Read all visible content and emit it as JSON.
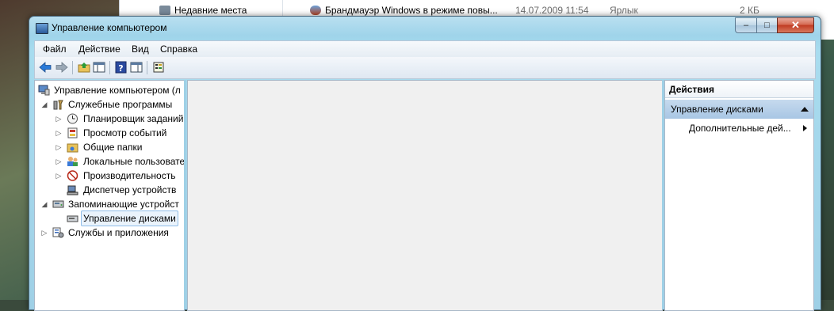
{
  "background": {
    "nav_item": "Недавние места",
    "file": {
      "name": "Брандмауэр Windows в режиме повы...",
      "date": "14.07.2009 11:54",
      "type": "Ярлык",
      "size": "2 КБ"
    }
  },
  "window": {
    "title": "Управление компьютером",
    "controls": {
      "minimize": "–",
      "maximize": "□",
      "close": "✕"
    }
  },
  "menu": [
    "Файл",
    "Действие",
    "Вид",
    "Справка"
  ],
  "toolbar": [
    {
      "icon": "back-arrow-icon"
    },
    {
      "icon": "forward-arrow-icon"
    },
    {
      "icon": "up-folder-icon"
    },
    {
      "icon": "show-hide-console-tree-icon"
    },
    {
      "icon": "help-icon"
    },
    {
      "icon": "show-hide-action-pane-icon"
    },
    {
      "icon": "properties-icon"
    }
  ],
  "tree": [
    {
      "label": "Управление компьютером (л",
      "icon": "computer-management-icon",
      "level": 0,
      "expander": ""
    },
    {
      "label": "Служебные программы",
      "icon": "system-tools-icon",
      "level": 1,
      "expander": "◢"
    },
    {
      "label": "Планировщик заданий",
      "icon": "task-scheduler-icon",
      "level": 2,
      "expander": "▷"
    },
    {
      "label": "Просмотр событий",
      "icon": "event-viewer-icon",
      "level": 2,
      "expander": "▷"
    },
    {
      "label": "Общие папки",
      "icon": "shared-folders-icon",
      "level": 2,
      "expander": "▷"
    },
    {
      "label": "Локальные пользовате",
      "icon": "local-users-icon",
      "level": 2,
      "expander": "▷"
    },
    {
      "label": "Производительность",
      "icon": "performance-icon",
      "level": 2,
      "expander": "▷"
    },
    {
      "label": "Диспетчер устройств",
      "icon": "device-manager-icon",
      "level": 2,
      "expander": ""
    },
    {
      "label": "Запоминающие устройст",
      "icon": "storage-icon",
      "level": 1,
      "expander": "◢"
    },
    {
      "label": "Управление дисками",
      "icon": "disk-management-icon",
      "level": 2,
      "expander": "",
      "selected": true
    },
    {
      "label": "Службы и приложения",
      "icon": "services-applications-icon",
      "level": 1,
      "expander": "▷"
    }
  ],
  "actions": {
    "header": "Действия",
    "section": "Управление дисками",
    "item": "Дополнительные дей..."
  }
}
